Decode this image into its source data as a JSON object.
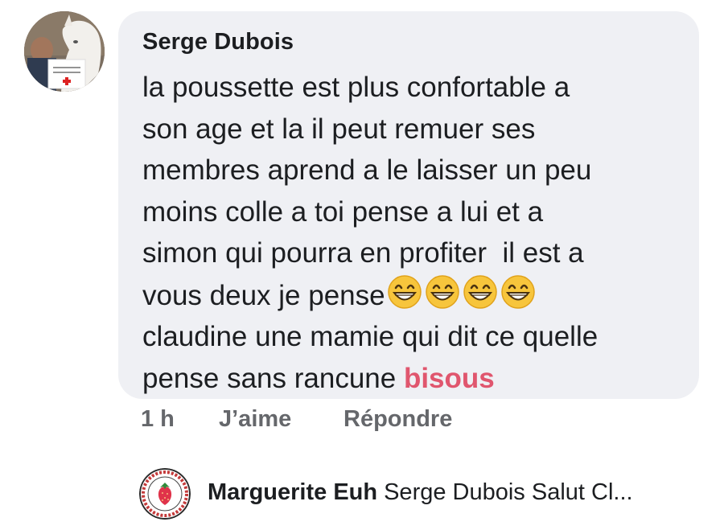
{
  "comment": {
    "author": "Serge Dubois",
    "lines": [
      "la poussette est plus confortable a",
      "son age et la il peut remuer ses",
      "membres aprend a le laisser un peu",
      "moins colle a toi pense a lui et a",
      "simon qui pourra en profiter  il est a",
      "vous deux je pense",
      "claudine une mamie qui dit ce quelle",
      "pense sans rancune "
    ],
    "highlight_word": "bisous",
    "emojis": [
      "grinning-face-emoji",
      "grinning-face-emoji",
      "grinning-face-emoji",
      "grinning-face-emoji"
    ],
    "highlight_color": "#e0566e",
    "avatar_sign_text": "Je soutiens les Chevaux Humbles!"
  },
  "actions": {
    "time": "1 h",
    "like": "J’aime",
    "reply": "Répondre"
  },
  "reply_preview": {
    "author": "Marguerite Euh",
    "snippet": "Serge Dubois Salut Cl...",
    "avatar_ring_text": "Chevaux Caramels Chemin pédagogique"
  },
  "colors": {
    "bubble_bg": "#eff0f4",
    "text": "#1c1e21",
    "secondary": "#65676b"
  }
}
